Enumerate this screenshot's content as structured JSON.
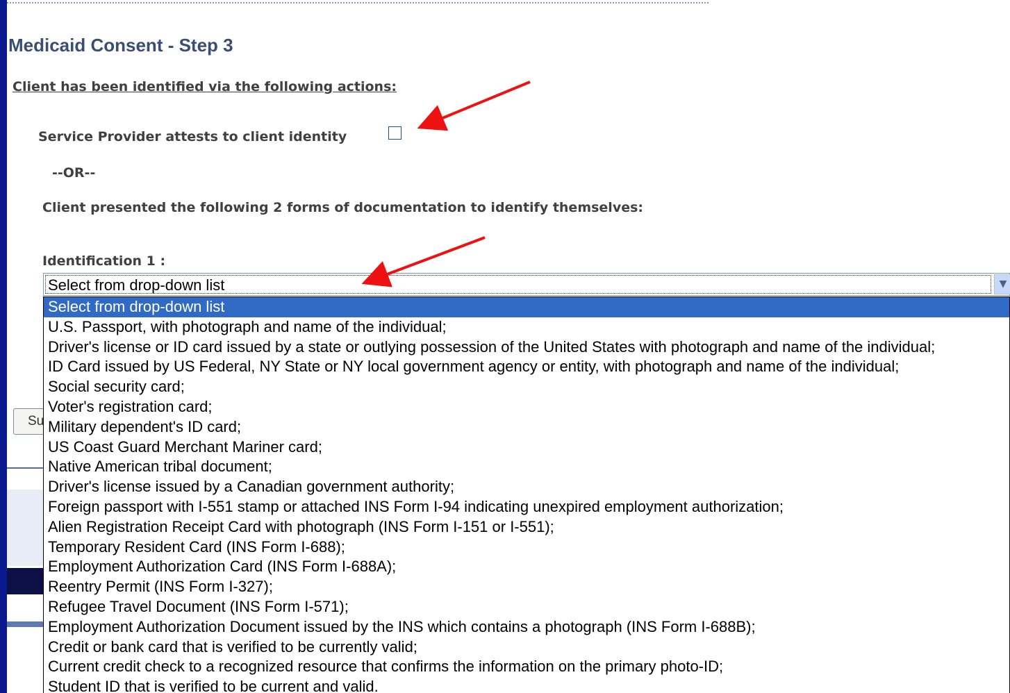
{
  "page": {
    "title": "Medicaid Consent - Step 3",
    "section_heading": "Client has been identified via the following actions:",
    "attest_label": "Service Provider attests to client identity",
    "attest_checked": false,
    "or_label": "--OR--",
    "documents_label": "Client presented the following 2 forms of documentation to identify themselves:",
    "identification1_label": "Identification 1 :"
  },
  "identification1_select": {
    "value": "Select from drop-down list",
    "options": [
      "Select from drop-down list",
      "U.S. Passport, with photograph and name of the individual;",
      "Driver's license or ID card issued by a state or outlying possession of the United States with photograph and name of the individual;",
      "ID Card issued by US Federal, NY State or NY local government agency or entity, with photograph and name of the individual;",
      "Social security card;",
      "Voter's registration card;",
      "Military dependent's ID card;",
      "US Coast Guard Merchant Mariner card;",
      "Native American tribal document;",
      "Driver's license issued by a Canadian government authority;",
      "Foreign passport with I-551 stamp or attached INS Form I-94 indicating unexpired employment authorization;",
      "Alien Registration Receipt Card with photograph (INS Form I-151 or I-551);",
      "Temporary Resident Card (INS Form I-688);",
      "Employment Authorization Card (INS Form I-688A);",
      "Reentry Permit (INS Form I-327);",
      "Refugee Travel Document (INS Form I-571);",
      "Employment Authorization Document issued by the INS which contains a photograph (INS Form I-688B);",
      "Credit or bank card that is verified to be currently valid;",
      "Current credit check to a recognized resource that confirms the information on the primary photo-ID;",
      "Student ID that is verified to be current and valid."
    ],
    "highlighted_index": 0
  },
  "submit_button": {
    "label": "Su"
  },
  "annotations": {
    "arrow_color": "#ee1111"
  },
  "icons": {
    "dropdown_button": "chevron-down-icon"
  }
}
